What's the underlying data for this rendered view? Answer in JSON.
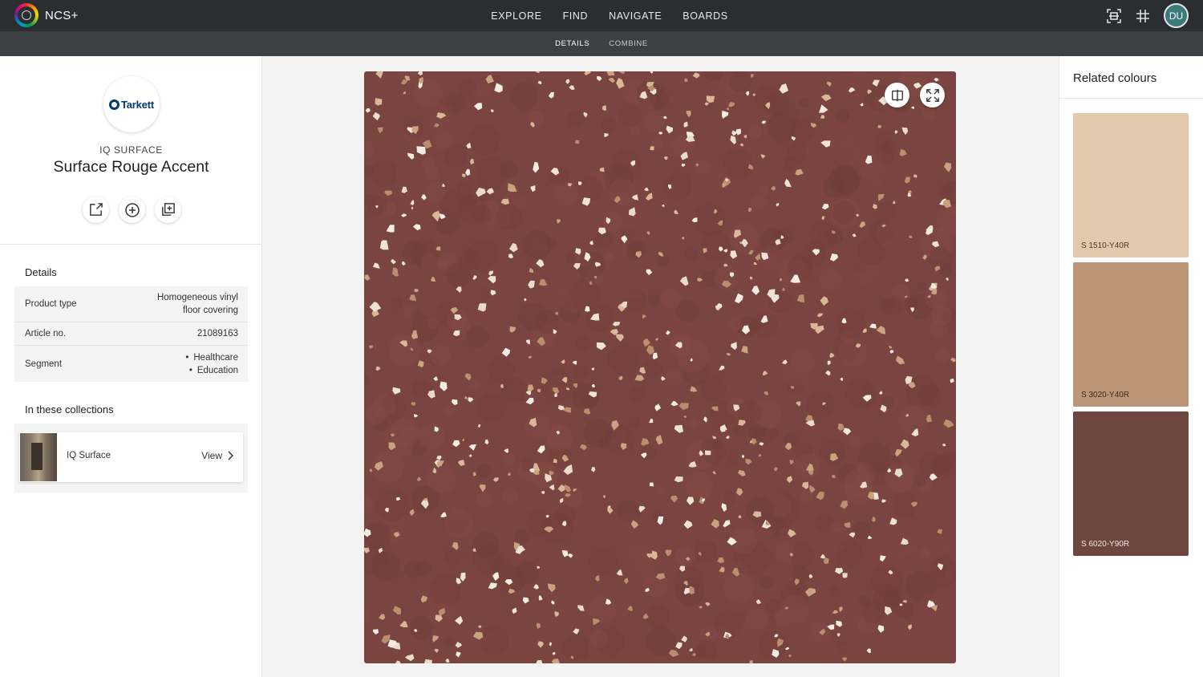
{
  "app": {
    "name": "NCS+"
  },
  "nav": {
    "items": [
      "EXPLORE",
      "FIND",
      "NAVIGATE",
      "BOARDS"
    ]
  },
  "user": {
    "initials": "DU"
  },
  "subnav": {
    "items": [
      "DETAILS",
      "COMBINE"
    ],
    "active": "DETAILS"
  },
  "product": {
    "brand": "Tarkett",
    "collection": "IQ SURFACE",
    "title": "Surface Rouge Accent",
    "base_color": "#7a4440"
  },
  "details": {
    "heading": "Details",
    "rows": [
      {
        "label": "Product type",
        "lines": [
          "Homogeneous vinyl",
          "floor covering"
        ]
      },
      {
        "label": "Article no.",
        "lines": [
          "21089163"
        ]
      },
      {
        "label": "Segment",
        "bullets": [
          "Healthcare",
          "Education"
        ]
      }
    ]
  },
  "collections": {
    "heading": "In these collections",
    "items": [
      {
        "name": "IQ Surface",
        "action": "View"
      }
    ]
  },
  "related": {
    "heading": "Related colours",
    "colors": [
      {
        "code": "S 1510-Y40R",
        "hex": "#e2c9ad",
        "text_color": "#4a3a2c"
      },
      {
        "code": "S 3020-Y40R",
        "hex": "#bc9676",
        "text_color": "#3a2a1e"
      },
      {
        "code": "S 6020-Y90R",
        "hex": "#6e4640",
        "text_color": "#f2e6e2"
      }
    ]
  }
}
